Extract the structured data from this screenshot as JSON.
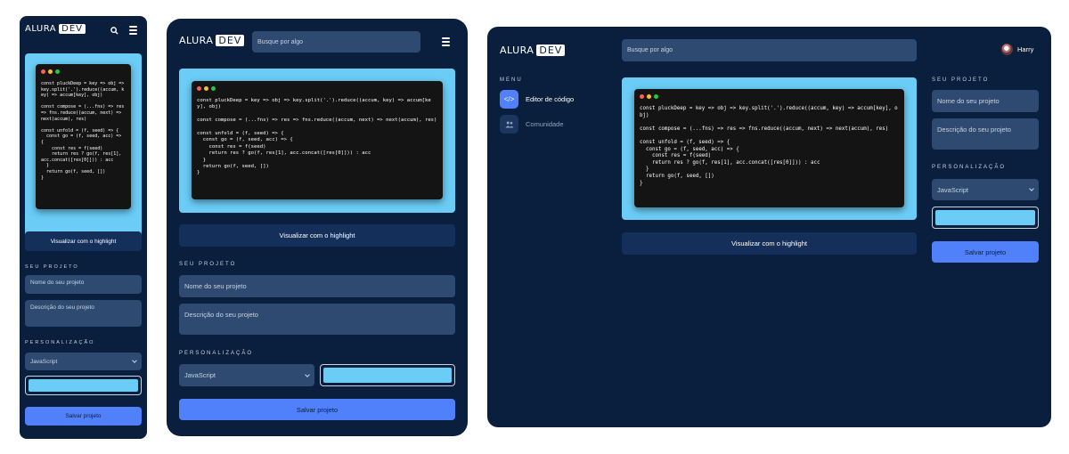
{
  "brand": {
    "word": "ALURA",
    "boxed": "DEV"
  },
  "search": {
    "placeholder": "Busque por algo"
  },
  "code": {
    "lines": "const pluckDeep = key => obj => key.split('.').reduce((accum, key) => accum[key], obj)\n\nconst compose = (...fns) => res => fns.reduce((accum, next) => next(accum), res)\n\nconst unfold = (f, seed) => {\n  const go = (f, seed, acc) => {\n    const res = f(seed)\n    return res ? go(f, res[1], acc.concat([res[0]])) : acc\n  }\n  return go(f, seed, [])\n}"
  },
  "buttons": {
    "highlight": "Visualizar com o highlight",
    "save": "Salvar projeto"
  },
  "project": {
    "section": "SEU PROJETO",
    "name_placeholder": "Nome do seu projeto",
    "description_placeholder": "Descrição do seu projeto"
  },
  "customization": {
    "section": "PERSONALIZAÇÃO",
    "language": "JavaScript",
    "color": "#6bcdf6"
  },
  "menu": {
    "title": "MENU",
    "items": [
      {
        "label": "Editor de código",
        "icon": "code-icon",
        "active": true
      },
      {
        "label": "Comunidade",
        "icon": "people-icon",
        "active": false
      }
    ]
  },
  "user": {
    "name": "Harry"
  },
  "colors": {
    "background": "#0a1f3d",
    "accent": "#5081fb",
    "editor_bg": "#6bcdf6",
    "field": "#2e4a70"
  }
}
